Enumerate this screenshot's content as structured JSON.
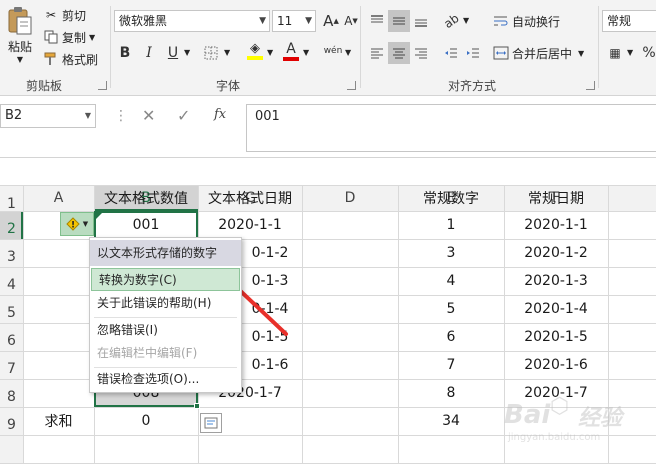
{
  "ribbon": {
    "clipboard": {
      "paste": "粘贴",
      "cut": "剪切",
      "copy": "复制",
      "format_painter": "格式刷",
      "label": "剪贴板"
    },
    "font": {
      "name": "微软雅黑",
      "size": "11",
      "bold": "B",
      "italic": "I",
      "underline": "U",
      "grow": "A",
      "shrink": "A",
      "font_color": "A",
      "phonetic": "wén",
      "label": "字体",
      "fill_color": "#ffff00",
      "text_color": "#e00000"
    },
    "alignment": {
      "wrap_text": "自动换行",
      "merge_center": "合并后居中",
      "label": "对齐方式"
    },
    "number": {
      "format": "常规",
      "percent": "%"
    }
  },
  "formula_bar": {
    "name_box": "B2",
    "fx": "fx",
    "value": "001"
  },
  "grid": {
    "columns": [
      "A",
      "B",
      "C",
      "D",
      "E",
      "F"
    ],
    "rows": [
      "1",
      "2",
      "3",
      "4",
      "5",
      "6",
      "7",
      "8",
      "9"
    ],
    "headers": {
      "B": "文本格式数值",
      "C": "文本格式日期",
      "E": "常规数字",
      "F": "常规日期"
    },
    "col_b": [
      "001",
      "",
      "",
      "",
      "",
      "",
      "008"
    ],
    "col_c": [
      "2020-1-1",
      "0-1-2",
      "0-1-3",
      "0-1-4",
      "0-1-5",
      "0-1-6",
      "2020-1-7"
    ],
    "col_e": [
      "1",
      "3",
      "4",
      "5",
      "6",
      "7",
      "8"
    ],
    "col_f": [
      "2020-1-1",
      "2020-1-2",
      "2020-1-3",
      "2020-1-4",
      "2020-1-5",
      "2020-1-6",
      "2020-1-7"
    ],
    "sum_label": "求和",
    "sum_b": "0",
    "sum_e": "34"
  },
  "error_menu": {
    "header": "以文本形式存储的数字",
    "convert": "转换为数字(C)",
    "help": "关于此错误的帮助(H)",
    "ignore": "忽略错误(I)",
    "edit_in_bar": "在编辑栏中编辑(F)",
    "options": "错误检查选项(O)..."
  },
  "colors": {
    "selection": "#217346",
    "arrow": "#e8302a",
    "warning": "#f5c400"
  }
}
